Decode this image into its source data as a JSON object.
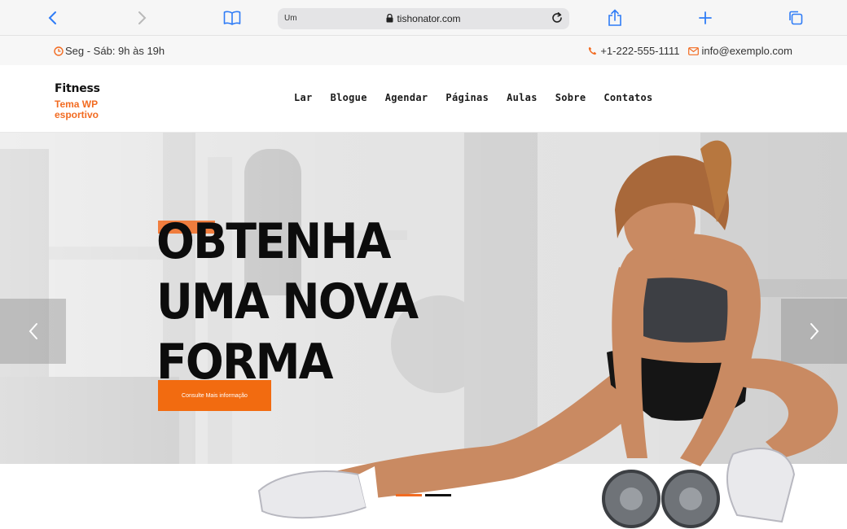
{
  "browser": {
    "url": "tishonator.com",
    "tab_ghost": "Um",
    "icons": [
      "back-icon",
      "forward-icon",
      "bookmarks-icon",
      "lock-icon",
      "reload-icon",
      "share-icon",
      "new-tab-icon",
      "tabs-icon"
    ]
  },
  "info": {
    "hours": "Seg - Sáb: 9h às 19h",
    "phone": "+1-222-555-1111",
    "email": "info@exemplo.com",
    "icons": [
      "clock-icon",
      "phone-icon",
      "envelope-icon"
    ]
  },
  "header": {
    "site_name": "Fitness",
    "tagline": "Tema WP esportivo",
    "nav": [
      "Lar",
      "Blogue",
      "Agendar",
      "Páginas",
      "Aulas",
      "Sobre",
      "Contatos"
    ]
  },
  "hero": {
    "headline": [
      "OBTENHA",
      "UMA NOVA",
      "FORMA"
    ],
    "cta_label": "Consulte Mais informação",
    "slide_count": 2,
    "active_slide": 1
  },
  "colors": {
    "accent": "#f26b21",
    "text_dark": "#0c0c0c",
    "browser_blue": "#2f7cf6"
  }
}
